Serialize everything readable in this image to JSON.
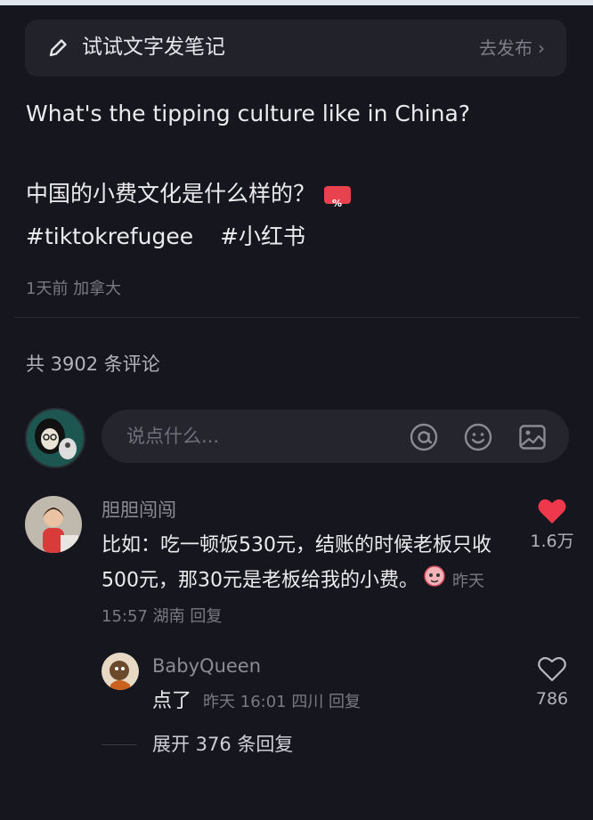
{
  "note_bar": {
    "label": "试试文字发笔记",
    "publish": "去发布"
  },
  "post": {
    "title_en": "What's the tipping culture like in China?",
    "title_zh": "中国的小费文化是什么样的？",
    "tags": [
      "#tiktokrefugee",
      "#小红书"
    ],
    "meta": "1天前 加拿大"
  },
  "comments_count": "共 3902 条评论",
  "input": {
    "placeholder": "说点什么..."
  },
  "comments": [
    {
      "author": "胆胆闯闯",
      "text": "比如：吃一顿饭530元，结账的时候老板只收500元，那30元是老板给我的小费。",
      "meta": "昨天 15:57 湖南 回复",
      "likes": "1.6万",
      "liked": true,
      "reply": {
        "author": "BabyQueen",
        "text": "点了",
        "meta": "昨天 16:01 四川 回复",
        "likes": "786",
        "liked": false
      }
    }
  ],
  "expand": "展开 376 条回复",
  "colors": {
    "background": "#16161e",
    "like_red": "#f0384c",
    "text": "#ececef",
    "muted": "#7a7a82"
  }
}
